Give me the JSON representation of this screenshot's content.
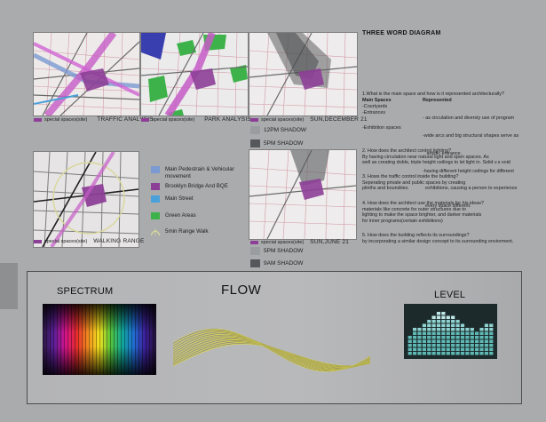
{
  "maps": {
    "traffic": {
      "legend": "special spaces(site)",
      "name": "TRAFFIC ANALYSIS"
    },
    "park": {
      "legend": "special spaces(site)",
      "name": "PARK ANALYSIS"
    },
    "december": {
      "legend": "special spaces(site)",
      "name": "SUN,DECEMBER 21"
    },
    "walking": {
      "legend": "special spaces(site)",
      "name": "WALKING RANGE"
    },
    "june": {
      "legend": "special spaces(site)",
      "name": "SUN,JUNE 21"
    }
  },
  "shadows_december": [
    {
      "label": "12PM SHADOW",
      "color": "#9a9d9f"
    },
    {
      "label": "5PM SHADOW",
      "color": "#55585b"
    }
  ],
  "shadows_june": [
    {
      "label": "5PM SHADOW",
      "color": "#9a9d9f"
    },
    {
      "label": "9AM SHADOW",
      "color": "#55585b"
    }
  ],
  "legend": [
    {
      "label": "Main Pedestrain & Vehicular movement",
      "color": "#7b9ad1"
    },
    {
      "label": "Brooklyn Bridge And BQE",
      "color": "#8d3f97"
    },
    {
      "label": "Main Street",
      "color": "#4aa0d8"
    },
    {
      "label": "Green Areas",
      "color": "#3eb24a"
    },
    {
      "label": "5min Range Walk",
      "color": "#dede9a"
    }
  ],
  "diagram": {
    "title": "THREE WORD DIAGRAM",
    "q1": "1.What is the main space and how is it represented architecturally?",
    "main_spaces_head": "Main Spaces",
    "represented_head": "Represented",
    "spaces": [
      "-Courtyards",
      "-Entrances",
      "",
      "-Exhibition spaces"
    ],
    "represented": [
      "- as circulation and diversty use of program",
      "-wide arcs and big structural shapes serve as",
      "   artistic entrance.",
      "-having different height ceilings for different",
      "  exhibitions, causing a person to experience",
      "  every space different."
    ],
    "q2": "2. How does the architect control lighting?",
    "a2": [
      "By having circulation near natural light and open spaces. As",
      "well as creating doble, triple height ceilings to let light in. Solid v.s void"
    ],
    "q3": "3. Hows the traffic control inside the building?",
    "a3": [
      "Seperating private and public spaces by creating",
      "plinths and boundries."
    ],
    "q4": "4. How does the architect use the materials for his ideas?",
    "a4": [
      "materials like concrete for outer structures due to",
      "lighting to make the space brighter, and darker materials",
      "for inner programs(certain exhibitions)"
    ],
    "q5": "5. How does the building reflects its surroundings?",
    "a5": [
      "by incorporating a similar design concept to its surrounding enviorment."
    ]
  },
  "bottom": {
    "spectrum": "SPECTRUM",
    "flow": "FLOW",
    "level": "LEVEL"
  },
  "level_bars": [
    0.45,
    0.55,
    0.62,
    0.7,
    0.78,
    0.82,
    0.88,
    0.92,
    0.85,
    0.8,
    0.72,
    0.68,
    0.6,
    0.55,
    0.5,
    0.58,
    0.66,
    0.7
  ]
}
